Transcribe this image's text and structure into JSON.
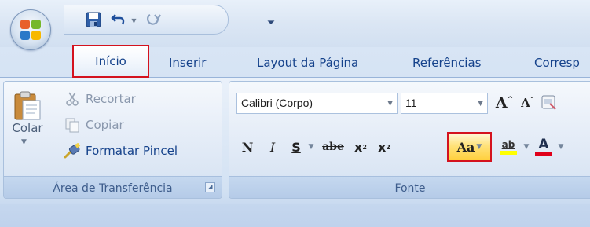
{
  "tabs": [
    {
      "label": "Início"
    },
    {
      "label": "Inserir"
    },
    {
      "label": "Layout da Página"
    },
    {
      "label": "Referências"
    },
    {
      "label": "Corresp"
    }
  ],
  "clipboard": {
    "paste_label": "Colar",
    "cut_label": "Recortar",
    "copy_label": "Copiar",
    "format_painter_label": "Formatar Pincel",
    "group_label": "Área de Transferência"
  },
  "font": {
    "font_name": "Calibri (Corpo)",
    "font_size": "11",
    "group_label": "Fonte",
    "bold_glyph": "N",
    "italic_glyph": "I",
    "underline_glyph": "S",
    "strike_glyph": "abe",
    "subscript_glyph": "x",
    "superscript_glyph": "x",
    "change_case_glyph": "Aa",
    "highlight_glyph": "ab",
    "font_color_glyph": "A",
    "grow_glyph": "A",
    "shrink_glyph": "A"
  },
  "colors": {
    "highlight_annotation": "#d4121e",
    "highlight_color": "#ffff00",
    "font_color": "#e0001a"
  },
  "icons": [
    "office-logo",
    "save-icon",
    "undo-icon",
    "redo-icon",
    "paste-icon",
    "scissors-icon",
    "copy-icon",
    "brush-icon",
    "clear-formatting-icon"
  ]
}
